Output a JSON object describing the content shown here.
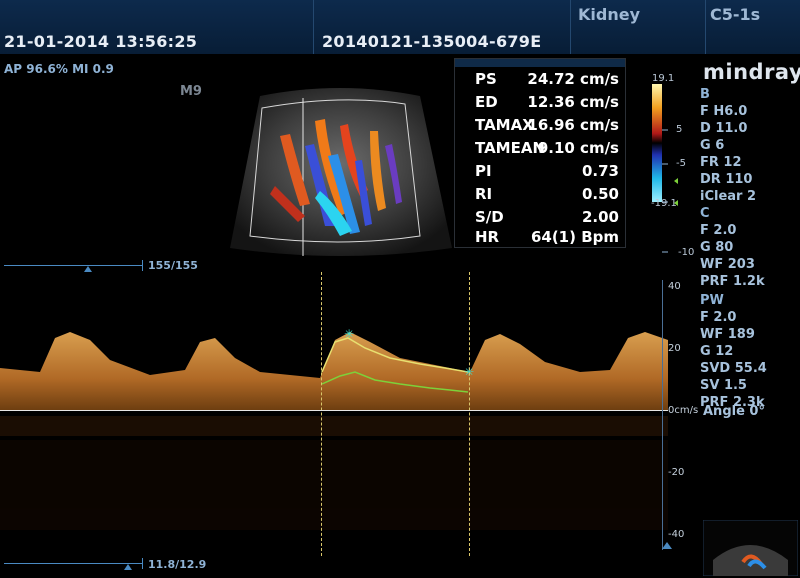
{
  "header": {
    "datetime": "21-01-2014 13:56:25",
    "exam_id": "20140121-135004-679E",
    "preset": "Kidney",
    "probe": "C5-1s"
  },
  "status": {
    "ap_mi": "AP 96.6%  MI 0.9",
    "image_mode": "M9"
  },
  "brand": "mindray",
  "measurements": [
    {
      "label": "PS",
      "value": "24.72 cm/s"
    },
    {
      "label": "ED",
      "value": "12.36 cm/s"
    },
    {
      "label": "TAMAX",
      "value": "16.96 cm/s"
    },
    {
      "label": "TAMEAN",
      "value": "9.10 cm/s"
    },
    {
      "label": "PI",
      "value": "0.73"
    },
    {
      "label": "RI",
      "value": "0.50"
    },
    {
      "label": "S/D",
      "value": "2.00"
    },
    {
      "label": "HR",
      "value": "64(1) Bpm"
    }
  ],
  "color_scale": {
    "top": "19.1",
    "bottom": "-19.1",
    "mid_marks": [
      "5",
      "-5",
      "-10"
    ]
  },
  "params": {
    "b": [
      "B",
      "F H6.0",
      "D 11.0",
      "G 6",
      "FR 12",
      "DR 110",
      "iClear 2"
    ],
    "c": [
      "C",
      "F 2.0",
      "G 80",
      "WF 203",
      "PRF 1.2k"
    ],
    "pw": [
      "PW",
      "F 2.0",
      "WF 189",
      "G 12",
      "SVD 55.4",
      "SV 1.5",
      "PRF 2.3k"
    ],
    "angle": "Angle 0°"
  },
  "timeline": {
    "top_counter": "155/155",
    "bottom_counter": "11.8/12.9"
  },
  "spectrum_scale": {
    "labels": [
      "40",
      "20",
      "0cm/s",
      "-20",
      "-40"
    ]
  },
  "colors": {
    "header_bg": "#0d2a4c",
    "doppler": "#d98a32",
    "trace_yellow": "#e8e070",
    "trace_green": "#7dd13a"
  }
}
